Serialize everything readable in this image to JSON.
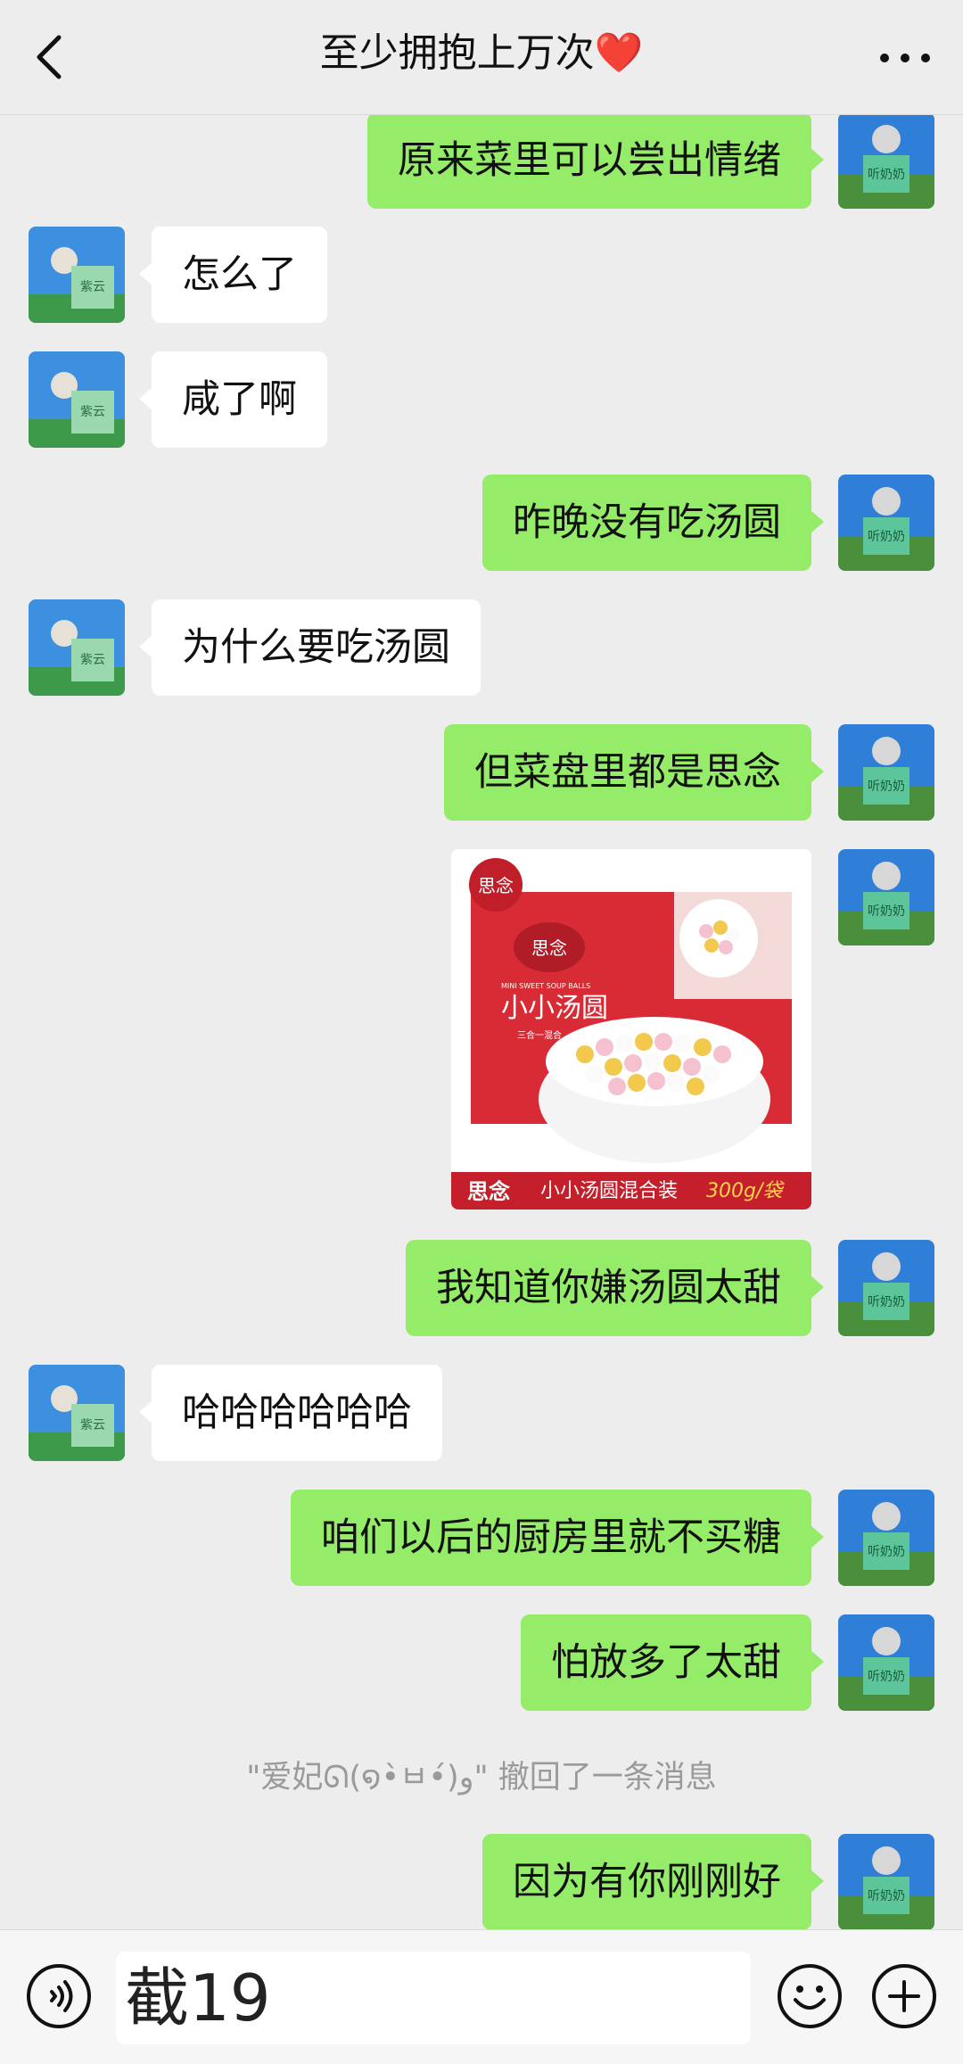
{
  "header": {
    "title": "至少拥抱上万次❤️"
  },
  "messages": [
    {
      "side": "me",
      "text": "原来菜里可以尝出情绪"
    },
    {
      "side": "them",
      "text": "怎么了"
    },
    {
      "side": "them",
      "text": "咸了啊"
    },
    {
      "side": "me",
      "text": "昨晚没有吃汤圆"
    },
    {
      "side": "them",
      "text": "为什么要吃汤圆"
    },
    {
      "side": "me",
      "text": "但菜盘里都是思念"
    },
    {
      "side": "me",
      "type": "image",
      "brand": "思念",
      "caption": "思念 小小汤圆混合装 300g/袋",
      "caption_brand": "思念",
      "caption_text": "小小汤圆混合装",
      "caption_weight": "300g/袋",
      "package_text": "小小汤圆",
      "package_sub": "MINI SWEET SOUP BALLS",
      "package_note": "三合一混合"
    },
    {
      "side": "me",
      "text": "我知道你嫌汤圆太甜"
    },
    {
      "side": "them",
      "text": "哈哈哈哈哈哈"
    },
    {
      "side": "me",
      "text": "咱们以后的厨房里就不买糖"
    },
    {
      "side": "me",
      "text": "怕放多了太甜"
    },
    {
      "type": "recall",
      "text": "\"爱妃ᘏ(໑•̀ㅂ•́)و\" 撤回了一条消息"
    },
    {
      "side": "me",
      "text": "因为有你刚刚好"
    }
  ],
  "input": {
    "value": "截19"
  },
  "colors": {
    "background": "#ededed",
    "my_bubble": "#95ec69",
    "their_bubble": "#ffffff"
  },
  "icons": {
    "back": "chevron-left-icon",
    "more": "more-dots-icon",
    "voice": "voice-icon",
    "emoji": "emoji-icon",
    "plus": "plus-icon"
  }
}
